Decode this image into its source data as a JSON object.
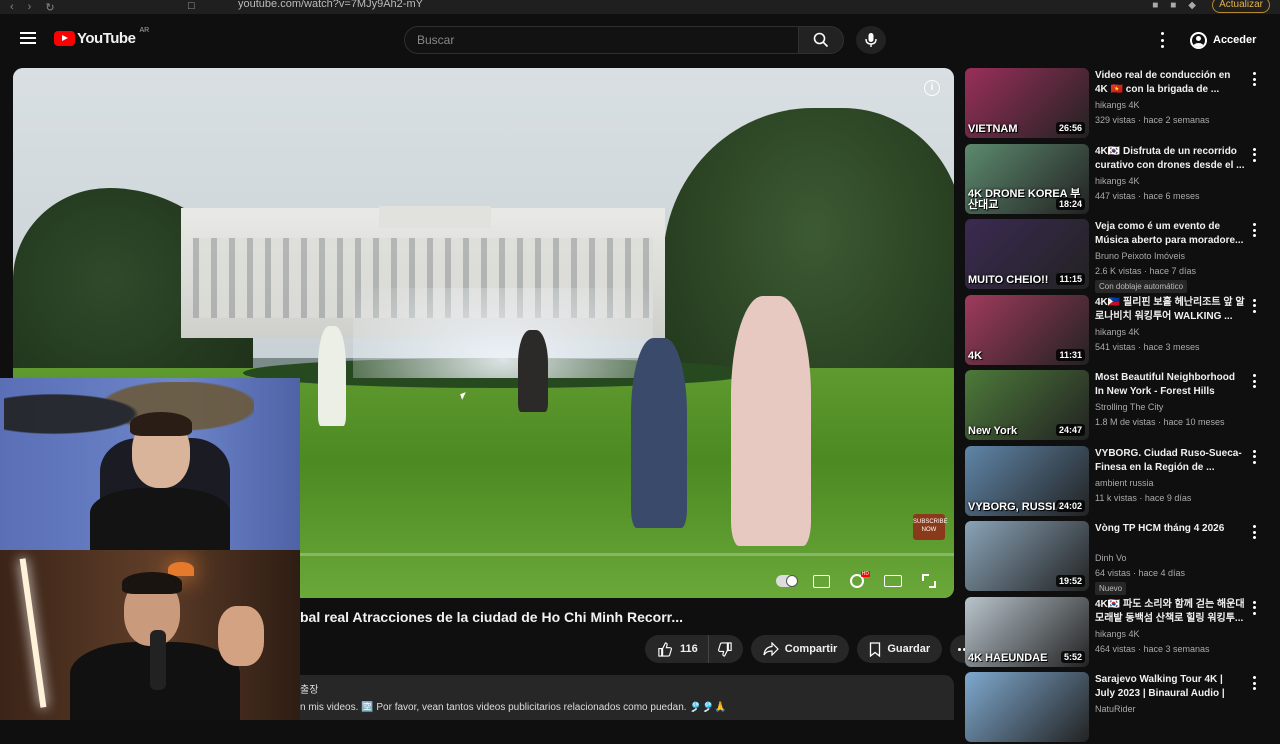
{
  "browser": {
    "url": "youtube.com/watch?v=7MJy9Ah2-mY",
    "update_label": "Actualizar"
  },
  "header": {
    "logo_text": "YouTube",
    "country_code": "AR",
    "search_placeholder": "Buscar",
    "signin_label": "Acceder"
  },
  "video": {
    "title": "bal real Atracciones de la ciudad de Ho Chi Minh Recorr...",
    "likes": "116",
    "share_label": "Compartir",
    "save_label": "Guardar",
    "badge_text": "SUBSCRIBE NOW",
    "description_line1": "출장",
    "description_line2": "n mis videos. 🈳 Por favor, vean tantos videos publicitarios relacionados como puedan. 🎐🎐🙏"
  },
  "recommendations": [
    {
      "title": "Video real de conducción en 4K 🇻🇳 con la brigada de ...",
      "channel": "hikangs 4K",
      "meta": "329 vistas · hace 2 semanas",
      "duration": "26:56",
      "thumb_text": "VIETNAM",
      "thumb_color": "#9a2f5a",
      "badge": ""
    },
    {
      "title": "4K🇰🇷 Disfruta de un recorrido curativo con drones desde el ...",
      "channel": "hikangs 4K",
      "meta": "447 vistas · hace 6 meses",
      "duration": "18:24",
      "thumb_text": "4K DRONE KOREA 부산대교",
      "thumb_color": "#5c8a6e",
      "badge": ""
    },
    {
      "title": "Veja como é um evento de Música aberto para moradore...",
      "channel": "Bruno Peixoto Imóveis",
      "meta": "2.6 K vistas · hace 7 días",
      "duration": "11:15",
      "thumb_text": "MUITO CHEIO!!",
      "thumb_color": "#3b2a52",
      "badge": "Con doblaje automático"
    },
    {
      "title": "4K🇵🇭 필리핀 보홀 헤난리조트 앞 알로나비치 워킹투어 WALKING ...",
      "channel": "hikangs 4K",
      "meta": "541 vistas · hace 3 meses",
      "duration": "11:31",
      "thumb_text": "4K",
      "thumb_color": "#a03a5c",
      "badge": ""
    },
    {
      "title": "Most Beautiful Neighborhood In New York - Forest Hills",
      "channel": "Strolling The City",
      "meta": "1.8 M de vistas · hace 10 meses",
      "duration": "24:47",
      "thumb_text": "New York",
      "thumb_color": "#4d7a3a",
      "badge": ""
    },
    {
      "title": "VYBORG. Ciudad Ruso-Sueca-Finesa en la Región de ...",
      "channel": "ambient russia",
      "meta": "11 k vistas · hace 9 días",
      "duration": "24:02",
      "thumb_text": "VYBORG, RUSSIA",
      "thumb_color": "#5f86a8",
      "badge": ""
    },
    {
      "title": "Vòng TP HCM tháng 4 2026",
      "channel": "Dinh Vo",
      "meta": "64 vistas · hace 4 días",
      "duration": "19:52",
      "thumb_text": "",
      "thumb_color": "#8aa4b8",
      "badge": "Nuevo"
    },
    {
      "title": "4K🇰🇷 파도 소리와 함께 걷는 해운대 모래밭 동백섬 산책로 힐링 워킹투...",
      "channel": "hikangs 4K",
      "meta": "464 vistas · hace 3 semanas",
      "duration": "5:52",
      "thumb_text": "4K HAEUNDAE",
      "thumb_color": "#b8c4cc",
      "badge": ""
    },
    {
      "title": "Sarajevo Walking Tour 4K | July 2023 | Binaural Audio | Bosnia ...",
      "channel": "NatuRider",
      "meta": "",
      "duration": "",
      "thumb_text": "",
      "thumb_color": "#7fa9cf",
      "badge": ""
    }
  ]
}
